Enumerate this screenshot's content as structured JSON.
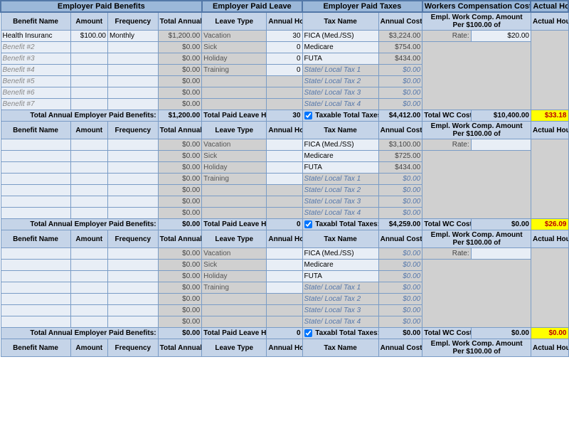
{
  "sections": {
    "benefits": "Employer Paid Benefits",
    "leave": "Employer Paid Leave",
    "taxes": "Employer Paid Taxes",
    "wc": "Workers Compensation Costs",
    "actual": "Actual Hourly"
  },
  "headers": {
    "benefit_name": "Benefit Name",
    "amount": "Amount",
    "frequency": "Frequency",
    "total_annual": "Total Annual",
    "leave_type": "Leave Type",
    "annual_hours": "Annual Hours",
    "tax_name": "Tax Name",
    "annual_cost": "Annual Cost",
    "wc_amount": "Empl. Work Comp. Amount Per $100.00  of",
    "actual_hourly": "Actual Hourly"
  },
  "totals_labels": {
    "benefits": "Total Annual Employer Paid Benefits:",
    "leave": "Total Paid Leave Hrs:",
    "taxes": "Total Taxes:",
    "taxable": "Taxable",
    "taxabl": "Taxabl",
    "wc": "Total WC Costs:",
    "rate": "Rate:"
  },
  "block1": {
    "benefits": [
      {
        "name": "Health Insuranc",
        "amount": "$100.00",
        "freq": "Monthly",
        "total": "$1,200.00"
      },
      {
        "name": "Benefit #2",
        "amount": "",
        "freq": "",
        "total": "$0.00"
      },
      {
        "name": "Benefit #3",
        "amount": "",
        "freq": "",
        "total": "$0.00"
      },
      {
        "name": "Benefit #4",
        "amount": "",
        "freq": "",
        "total": "$0.00"
      },
      {
        "name": "Benefit #5",
        "amount": "",
        "freq": "",
        "total": "$0.00"
      },
      {
        "name": "Benefit #6",
        "amount": "",
        "freq": "",
        "total": "$0.00"
      },
      {
        "name": "Benefit #7",
        "amount": "",
        "freq": "",
        "total": "$0.00"
      }
    ],
    "leave": [
      {
        "type": "Vacation",
        "hours": "30"
      },
      {
        "type": "Sick",
        "hours": "0"
      },
      {
        "type": "Holiday",
        "hours": "0"
      },
      {
        "type": "Training",
        "hours": "0"
      }
    ],
    "taxes": [
      {
        "name": "FICA (Med./SS)",
        "cost": "$3,224.00"
      },
      {
        "name": "Medicare",
        "cost": "$754.00"
      },
      {
        "name": "FUTA",
        "cost": "$434.00"
      },
      {
        "name": "State/ Local Tax 1",
        "cost": "$0.00",
        "ph": true
      },
      {
        "name": "State/ Local Tax 2",
        "cost": "$0.00",
        "ph": true
      },
      {
        "name": "State/ Local Tax 3",
        "cost": "$0.00",
        "ph": true
      },
      {
        "name": "State/ Local Tax 4",
        "cost": "$0.00",
        "ph": true
      }
    ],
    "wc_rate": "$20.00",
    "totals": {
      "benefits": "$1,200.00",
      "leave": "30",
      "taxes": "$4,412.00",
      "wc": "$10,400.00",
      "hourly": "$33.18"
    }
  },
  "block2": {
    "benefits": [
      {
        "name": "",
        "amount": "",
        "freq": "",
        "total": "$0.00"
      },
      {
        "name": "",
        "amount": "",
        "freq": "",
        "total": "$0.00"
      },
      {
        "name": "",
        "amount": "",
        "freq": "",
        "total": "$0.00"
      },
      {
        "name": "",
        "amount": "",
        "freq": "",
        "total": "$0.00"
      },
      {
        "name": "",
        "amount": "",
        "freq": "",
        "total": "$0.00"
      },
      {
        "name": "",
        "amount": "",
        "freq": "",
        "total": "$0.00"
      },
      {
        "name": "",
        "amount": "",
        "freq": "",
        "total": "$0.00"
      }
    ],
    "leave": [
      {
        "type": "Vacation",
        "hours": ""
      },
      {
        "type": "Sick",
        "hours": ""
      },
      {
        "type": "Holiday",
        "hours": ""
      },
      {
        "type": "Training",
        "hours": ""
      }
    ],
    "taxes": [
      {
        "name": "FICA (Med./SS)",
        "cost": "$3,100.00"
      },
      {
        "name": "Medicare",
        "cost": "$725.00"
      },
      {
        "name": "FUTA",
        "cost": "$434.00"
      },
      {
        "name": "State/ Local Tax 1",
        "cost": "$0.00",
        "ph": true
      },
      {
        "name": "State/ Local Tax 2",
        "cost": "$0.00",
        "ph": true
      },
      {
        "name": "State/ Local Tax 3",
        "cost": "$0.00",
        "ph": true
      },
      {
        "name": "State/ Local Tax 4",
        "cost": "$0.00",
        "ph": true
      }
    ],
    "wc_rate": "",
    "totals": {
      "benefits": "$0.00",
      "leave": "0",
      "taxes": "$4,259.00",
      "wc": "$0.00",
      "hourly": "$26.09"
    }
  },
  "block3": {
    "benefits": [
      {
        "name": "",
        "amount": "",
        "freq": "",
        "total": "$0.00"
      },
      {
        "name": "",
        "amount": "",
        "freq": "",
        "total": "$0.00"
      },
      {
        "name": "",
        "amount": "",
        "freq": "",
        "total": "$0.00"
      },
      {
        "name": "",
        "amount": "",
        "freq": "",
        "total": "$0.00"
      },
      {
        "name": "",
        "amount": "",
        "freq": "",
        "total": "$0.00"
      },
      {
        "name": "",
        "amount": "",
        "freq": "",
        "total": "$0.00"
      },
      {
        "name": "",
        "amount": "",
        "freq": "",
        "total": "$0.00"
      }
    ],
    "leave": [
      {
        "type": "Vacation",
        "hours": ""
      },
      {
        "type": "Sick",
        "hours": ""
      },
      {
        "type": "Holiday",
        "hours": ""
      },
      {
        "type": "Training",
        "hours": ""
      }
    ],
    "taxes": [
      {
        "name": "FICA (Med./SS)",
        "cost": "$0.00",
        "ph2": true
      },
      {
        "name": "Medicare",
        "cost": "$0.00",
        "ph2": true
      },
      {
        "name": "FUTA",
        "cost": "$0.00",
        "ph2": true
      },
      {
        "name": "State/ Local Tax 1",
        "cost": "$0.00",
        "ph": true
      },
      {
        "name": "State/ Local Tax 2",
        "cost": "$0.00",
        "ph": true
      },
      {
        "name": "State/ Local Tax 3",
        "cost": "$0.00",
        "ph": true
      },
      {
        "name": "State/ Local Tax 4",
        "cost": "$0.00",
        "ph": true
      }
    ],
    "wc_rate": "",
    "totals": {
      "benefits": "$0.00",
      "leave": "0",
      "taxes": "$0.00",
      "wc": "$0.00",
      "hourly": "$0.00"
    }
  }
}
